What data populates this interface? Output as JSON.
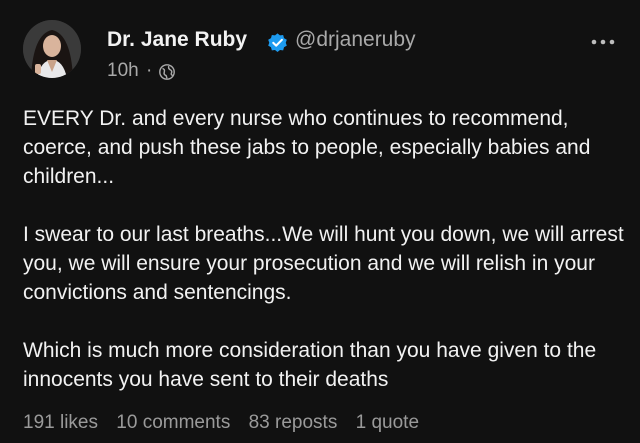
{
  "author": {
    "name": "Dr. Jane Ruby",
    "handle": "@drjaneruby",
    "verified": true,
    "avatar_icon": "profile-photo"
  },
  "meta": {
    "time": "10h",
    "separator": "·",
    "visibility_icon": "globe-icon"
  },
  "post": {
    "paragraphs": [
      "EVERY Dr. and every nurse who continues to recommend, coerce, and push these jabs to people, especially babies and children...",
      "I swear to our last breaths...We will hunt you down, we will arrest you, we will ensure your prosecution and we will relish in your convictions and sentencings.",
      "Which is much more consideration than you have given to the innocents you have sent to their deaths"
    ]
  },
  "stats": {
    "likes": "191 likes",
    "comments": "10 comments",
    "reposts": "83 reposts",
    "quotes": "1 quote"
  },
  "colors": {
    "background": "#111111",
    "text": "#f2f2f2",
    "muted": "#a9a9a9",
    "verified": "#1d9bf0"
  }
}
